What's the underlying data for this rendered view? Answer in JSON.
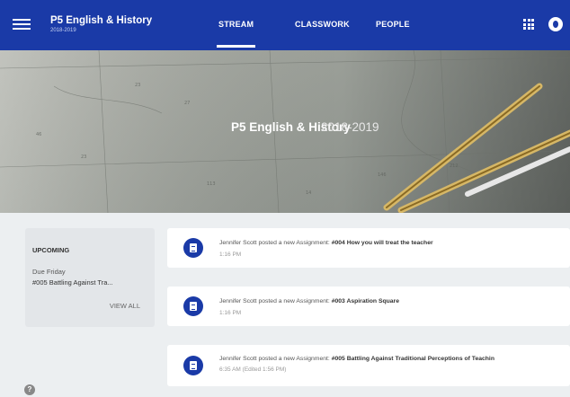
{
  "header": {
    "class_title": "P5 English & History",
    "class_subtitle": "2018-2019",
    "tabs": [
      {
        "label": "STREAM",
        "active": true
      },
      {
        "label": "CLASSWORK",
        "active": false
      },
      {
        "label": "PEOPLE",
        "active": false
      }
    ],
    "icons": [
      "menu-icon",
      "apps-grid-icon",
      "account-icon"
    ]
  },
  "banner": {
    "title": "P5 English & History",
    "year": "2018-2019"
  },
  "upcoming": {
    "heading": "UPCOMING",
    "due_label": "Due Friday",
    "item": "#005 Battling Against Tra...",
    "view_all": "VIEW ALL"
  },
  "posts": [
    {
      "author_text": "Jennifer Scott posted a new Assignment:",
      "assignment": "#004 How you will treat the teacher",
      "time": "1:16 PM"
    },
    {
      "author_text": "Jennifer Scott posted a new Assignment:",
      "assignment": "#003 Aspiration Square",
      "time": "1:16 PM"
    },
    {
      "author_text": "Jennifer Scott posted a new Assignment:",
      "assignment": "#005 Battling Against Traditional Perceptions of Teachin",
      "time": "6:35 AM (Edited 1:56 PM)"
    }
  ],
  "colors": {
    "topbar": "#1a3aa7",
    "background": "#eceff1",
    "card": "#ffffff"
  }
}
